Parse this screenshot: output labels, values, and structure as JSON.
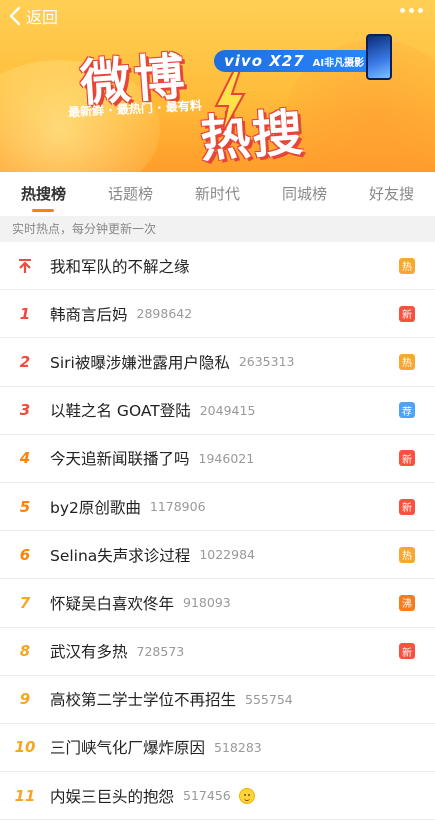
{
  "header": {
    "back_label": "返回",
    "logo_top": "微博",
    "logo_bottom": "热搜",
    "slogan": "最新鲜 · 最热门 · 最有料",
    "sponsor_brand": "vivo X27",
    "sponsor_tag": "AI非凡摄影"
  },
  "tabs": [
    {
      "label": "热搜榜",
      "active": true
    },
    {
      "label": "话题榜",
      "active": false
    },
    {
      "label": "新时代",
      "active": false
    },
    {
      "label": "同城榜",
      "active": false
    },
    {
      "label": "好友搜",
      "active": false
    }
  ],
  "subtitle": "实时热点，每分钟更新一次",
  "items": [
    {
      "rank": "",
      "title": "我和军队的不解之缘",
      "count": "",
      "badge": "热"
    },
    {
      "rank": "1",
      "title": "韩商言后妈",
      "count": "2898642",
      "badge": "新"
    },
    {
      "rank": "2",
      "title": "Siri被曝涉嫌泄露用户隐私",
      "count": "2635313",
      "badge": "热"
    },
    {
      "rank": "3",
      "title": "以鞋之名 GOAT登陆",
      "count": "2049415",
      "badge": "荐"
    },
    {
      "rank": "4",
      "title": "今天追新闻联播了吗",
      "count": "1946021",
      "badge": "新"
    },
    {
      "rank": "5",
      "title": "by2原创歌曲",
      "count": "1178906",
      "badge": "新"
    },
    {
      "rank": "6",
      "title": "Selina失声求诊过程",
      "count": "1022984",
      "badge": "热"
    },
    {
      "rank": "7",
      "title": "怀疑吴白喜欢佟年",
      "count": "918093",
      "badge": "沸"
    },
    {
      "rank": "8",
      "title": "武汉有多热",
      "count": "728573",
      "badge": "新"
    },
    {
      "rank": "9",
      "title": "高校第二学士学位不再招生",
      "count": "555754",
      "badge": ""
    },
    {
      "rank": "10",
      "title": "三门峡气化厂爆炸原因",
      "count": "518283",
      "badge": ""
    },
    {
      "rank": "11",
      "title": "内娱三巨头的抱怨",
      "count": "517456",
      "badge": ""
    }
  ],
  "colors": {
    "accent": "#ff8200",
    "badge_hot": "#f8a733",
    "badge_new": "#f8513d",
    "badge_recommend": "#4fa3f7",
    "badge_boil": "#f57c1f"
  }
}
